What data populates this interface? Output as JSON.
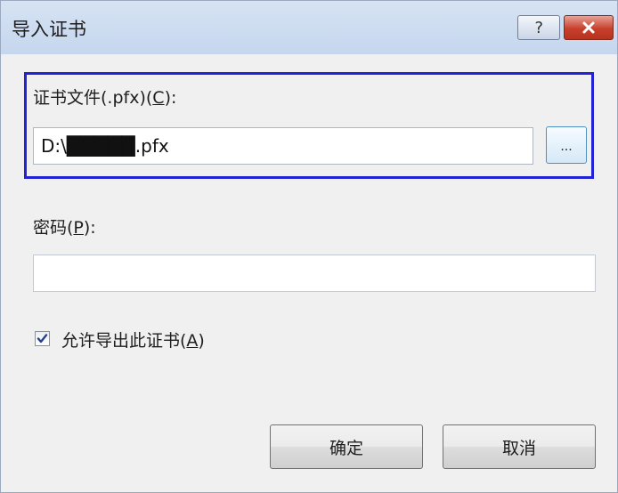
{
  "window": {
    "title": "导入证书",
    "help_label": "?",
    "close_icon": "close-icon"
  },
  "file_section": {
    "label_prefix": "证书文件(.pfx)(",
    "label_accel": "C",
    "label_suffix": "):",
    "value": "D:\\█████.pfx",
    "browse_label": "..."
  },
  "password_section": {
    "label_prefix": "密码(",
    "label_accel": "P",
    "label_suffix": "):",
    "value": ""
  },
  "export_option": {
    "checked": true,
    "label_prefix": "允许导出此证书(",
    "label_accel": "A",
    "label_suffix": ")"
  },
  "buttons": {
    "ok": "确定",
    "cancel": "取消"
  },
  "colors": {
    "focus_border": "#2323d6",
    "title_bar": "#c5d6ee",
    "close_button": "#c8402c"
  }
}
